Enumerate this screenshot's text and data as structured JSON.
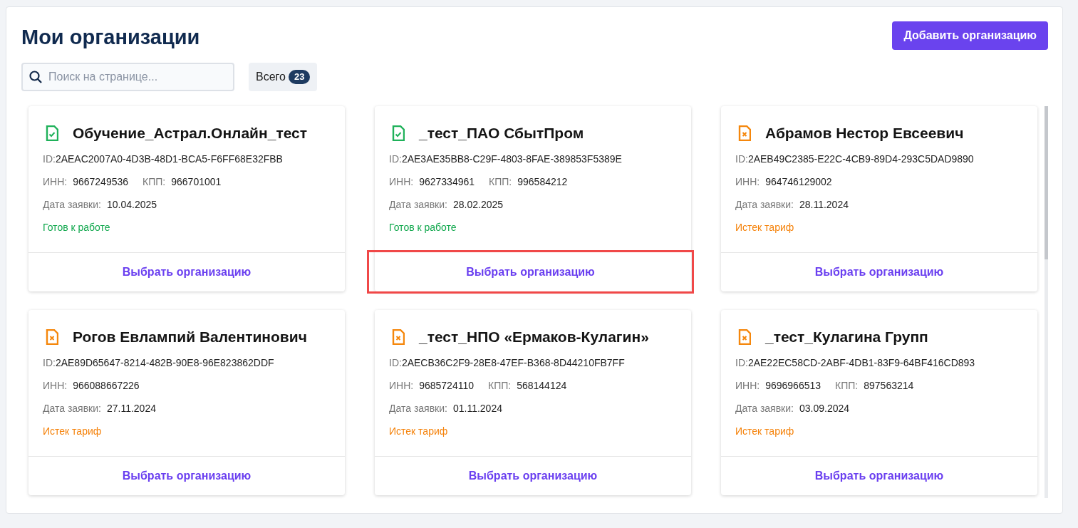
{
  "title": "Мои организации",
  "add_button": "Добавить организацию",
  "search": {
    "placeholder": "Поиск на странице..."
  },
  "total": {
    "label": "Всего",
    "count": "23"
  },
  "organizations": [
    {
      "name": "Обучение_Астрал.Онлайн_тест",
      "kind": "ready",
      "id_label": "ID:",
      "id": "2AEAC2007A0-4D3B-48D1-BCA5-F6FF68E32FBB",
      "inn_label": "ИНН:",
      "inn": "9667249536",
      "kpp_label": "КПП:",
      "kpp": "966701001",
      "date_label": "Дата заявки:",
      "date": "10.04.2025",
      "status": "Готов к работе",
      "button": "Выбрать организацию",
      "highlighted": false
    },
    {
      "name": "_тест_ПАО СбытПром",
      "kind": "ready",
      "id_label": "ID:",
      "id": "2AE3AE35BB8-C29F-4803-8FAE-389853F5389E",
      "inn_label": "ИНН:",
      "inn": "9627334961",
      "kpp_label": "КПП:",
      "kpp": "996584212",
      "date_label": "Дата заявки:",
      "date": "28.02.2025",
      "status": "Готов к работе",
      "button": "Выбрать организацию",
      "highlighted": true
    },
    {
      "name": "Абрамов Нестор Евсеевич",
      "kind": "expired",
      "id_label": "ID:",
      "id": "2AEB49C2385-E22C-4CB9-89D4-293C5DAD9890",
      "inn_label": "ИНН:",
      "inn": "964746129002",
      "date_label": "Дата заявки:",
      "date": "28.11.2024",
      "status": "Истек тариф",
      "button": "Выбрать организацию",
      "highlighted": false
    },
    {
      "name": "Рогов Евлампий Валентинович",
      "kind": "expired",
      "id_label": "ID:",
      "id": "2AE89D65647-8214-482B-90E8-96E823862DDF",
      "inn_label": "ИНН:",
      "inn": "966088667226",
      "date_label": "Дата заявки:",
      "date": "27.11.2024",
      "status": "Истек тариф",
      "button": "Выбрать организацию",
      "highlighted": false
    },
    {
      "name": "_тест_НПО «Ермаков-Кулагин»",
      "kind": "expired",
      "id_label": "ID:",
      "id": "2AECB36C2F9-28E8-47EF-B368-8D44210FB7FF",
      "inn_label": "ИНН:",
      "inn": "9685724110",
      "kpp_label": "КПП:",
      "kpp": "568144124",
      "date_label": "Дата заявки:",
      "date": "01.11.2024",
      "status": "Истек тариф",
      "button": "Выбрать организацию",
      "highlighted": false
    },
    {
      "name": "_тест_Кулагина Групп",
      "kind": "expired",
      "id_label": "ID:",
      "id": "2AE22EC58CD-2ABF-4DB1-83F9-64BF416CD893",
      "inn_label": "ИНН:",
      "inn": "9696966513",
      "kpp_label": "КПП:",
      "kpp": "897563214",
      "date_label": "Дата заявки:",
      "date": "03.09.2024",
      "status": "Истек тариф",
      "button": "Выбрать организацию",
      "highlighted": false
    }
  ]
}
